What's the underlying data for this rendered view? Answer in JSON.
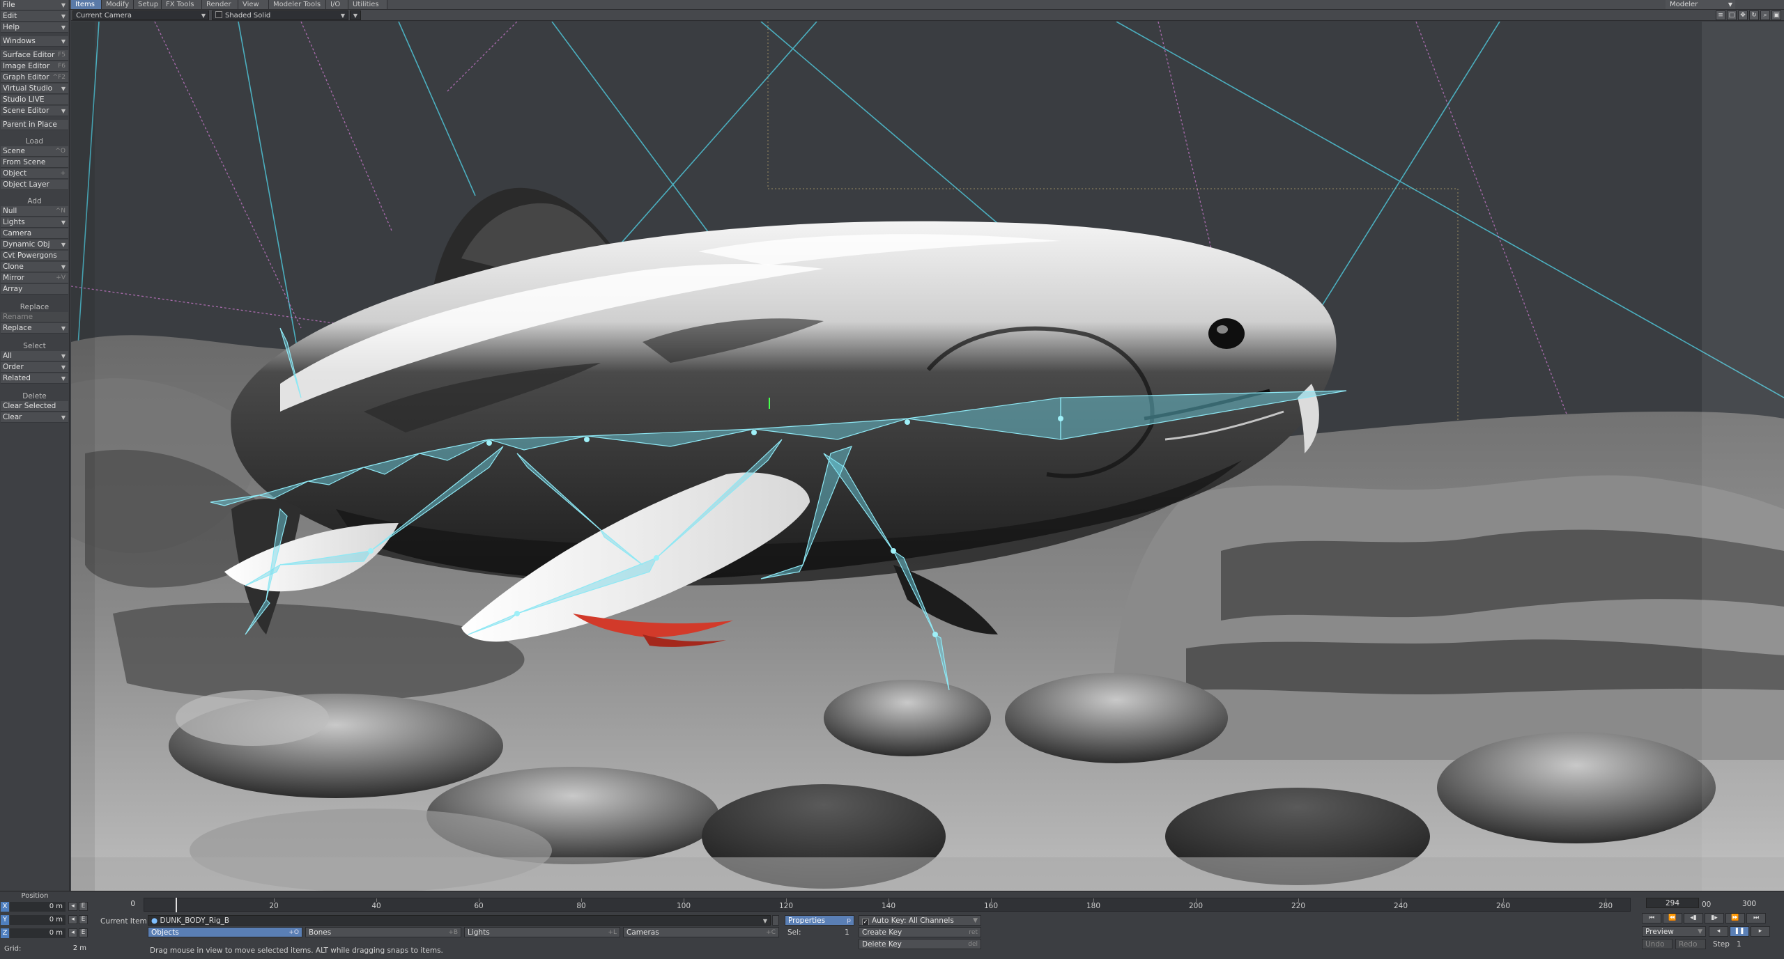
{
  "top_tabs": [
    "Items",
    "Modify",
    "Setup",
    "FX Tools",
    "Render",
    "View",
    "Modeler Tools",
    "I/O",
    "Utilities"
  ],
  "active_tab": "Items",
  "modeler_button": "Modeler",
  "viewport": {
    "camera": "Current Camera",
    "shading": "Shaded Solid"
  },
  "toolbar": {
    "file": "File",
    "edit": "Edit",
    "help": "Help",
    "windows": "Windows",
    "surface_editor": "Surface Editor",
    "surface_editor_sc": "F5",
    "image_editor": "Image Editor",
    "image_editor_sc": "F6",
    "graph_editor": "Graph Editor",
    "graph_editor_sc": "^F2",
    "virtual_studio": "Virtual Studio",
    "studio_live": "Studio LIVE",
    "scene_editor": "Scene Editor",
    "parent_in_place": "Parent in Place",
    "load_head": "Load",
    "scene": "Scene",
    "scene_sc": "^O",
    "from_scene": "From Scene",
    "object": "Object",
    "object_sc": "+",
    "object_layer": "Object Layer",
    "add_head": "Add",
    "null": "Null",
    "null_sc": "^N",
    "lights": "Lights",
    "camera": "Camera",
    "dynamic_obj": "Dynamic Obj",
    "cvt_powergons": "Cvt Powergons",
    "clone": "Clone",
    "mirror": "Mirror",
    "mirror_sc": "+V",
    "array": "Array",
    "replace_head": "Replace",
    "rename": "Rename",
    "replace": "Replace",
    "select_head": "Select",
    "all": "All",
    "order": "Order",
    "related": "Related",
    "delete_head": "Delete",
    "clear_selected": "Clear Selected",
    "clear": "Clear"
  },
  "position": {
    "title": "Position",
    "x_label": "X",
    "x": "0 m",
    "y_label": "Y",
    "y": "0 m",
    "z_label": "Z",
    "z": "0 m",
    "grid_label": "Grid:",
    "grid": "2 m"
  },
  "timeline": {
    "start_frame": "0",
    "ticks": [
      "20",
      "40",
      "60",
      "80",
      "100",
      "120",
      "140",
      "160",
      "180",
      "200",
      "220",
      "240",
      "260",
      "280"
    ],
    "current_frame": "294",
    "current_frame_suffix": "00",
    "end_frame": "300"
  },
  "item_row": {
    "current_item_label": "Current Item",
    "current_item": "DUNK_BODY_Rig_B",
    "properties": "Properties",
    "properties_sc": "p",
    "auto_key": "Auto Key: All Channels",
    "objects": "Objects",
    "objects_sc": "+O",
    "bones": "Bones",
    "bones_sc": "+B",
    "lights": "Lights",
    "lights_sc": "+L",
    "cameras": "Cameras",
    "cameras_sc": "+C",
    "sel_label": "Sel:",
    "sel": "1",
    "create_key": "Create Key",
    "create_key_sc": "ret",
    "delete_key": "Delete Key",
    "delete_key_sc": "del",
    "preview": "Preview",
    "step_label": "Step",
    "step": "1",
    "undo": "Undo",
    "redo": "Redo",
    "status": "Drag mouse in view to move selected items. ALT while dragging snaps to items."
  }
}
